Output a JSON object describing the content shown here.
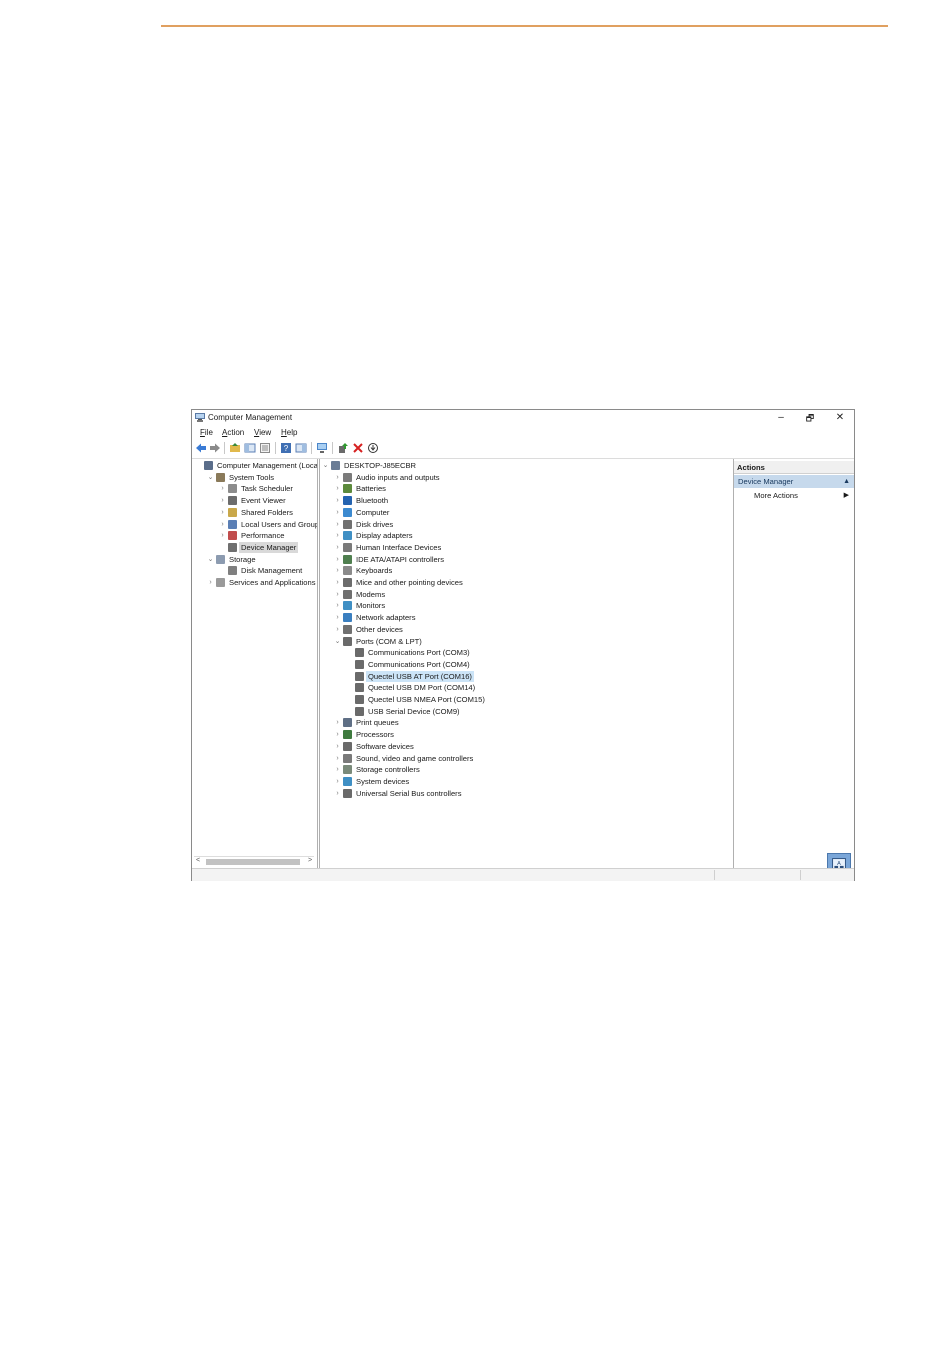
{
  "window": {
    "title": "Computer Management",
    "minimize": "–",
    "restore": "🗗",
    "close": "✕"
  },
  "menu": [
    "File",
    "Action",
    "View",
    "Help"
  ],
  "toolbar_icons": [
    "back-icon",
    "forward-icon",
    "up-folder-icon",
    "show-hide-tree-icon",
    "properties-icon",
    "help-icon",
    "show-hide-action-pane-icon",
    "computer-icon",
    "update-driver-icon",
    "uninstall-icon",
    "scan-hardware-icon"
  ],
  "left_tree": [
    {
      "label": "Computer Management (Local",
      "level": 0,
      "chev": "",
      "icon": "computer-management-icon",
      "color": "#5a6d8a"
    },
    {
      "label": "System Tools",
      "level": 1,
      "chev": "v",
      "icon": "tools-icon",
      "color": "#8a7a5a"
    },
    {
      "label": "Task Scheduler",
      "level": 2,
      "chev": ">",
      "icon": "clock-icon",
      "color": "#8c8c8c"
    },
    {
      "label": "Event Viewer",
      "level": 2,
      "chev": ">",
      "icon": "event-viewer-icon",
      "color": "#6c6c6c"
    },
    {
      "label": "Shared Folders",
      "level": 2,
      "chev": ">",
      "icon": "shared-folder-icon",
      "color": "#c9a84a"
    },
    {
      "label": "Local Users and Groups",
      "level": 2,
      "chev": ">",
      "icon": "users-icon",
      "color": "#5b7fb5"
    },
    {
      "label": "Performance",
      "level": 2,
      "chev": ">",
      "icon": "performance-icon",
      "color": "#c14d4d"
    },
    {
      "label": "Device Manager",
      "level": 2,
      "chev": "",
      "icon": "device-manager-icon",
      "color": "#6f6f6f",
      "selected": true
    },
    {
      "label": "Storage",
      "level": 1,
      "chev": "v",
      "icon": "storage-icon",
      "color": "#8c9bb0"
    },
    {
      "label": "Disk Management",
      "level": 2,
      "chev": "",
      "icon": "disk-management-icon",
      "color": "#7f7f7f"
    },
    {
      "label": "Services and Applications",
      "level": 1,
      "chev": ">",
      "icon": "services-icon",
      "color": "#9a9a9a"
    }
  ],
  "device_tree": [
    {
      "label": "DESKTOP-J85ECBR",
      "level": 0,
      "chev": "v",
      "icon": "computer-icon",
      "color": "#6a7c95"
    },
    {
      "label": "Audio inputs and outputs",
      "level": 1,
      "chev": ">",
      "icon": "audio-icon",
      "color": "#7b7b7b"
    },
    {
      "label": "Batteries",
      "level": 1,
      "chev": ">",
      "icon": "battery-icon",
      "color": "#5c8a3c"
    },
    {
      "label": "Bluetooth",
      "level": 1,
      "chev": ">",
      "icon": "bluetooth-icon",
      "color": "#2463b0"
    },
    {
      "label": "Computer",
      "level": 1,
      "chev": ">",
      "icon": "computer-icon",
      "color": "#3c8ad0"
    },
    {
      "label": "Disk drives",
      "level": 1,
      "chev": ">",
      "icon": "disk-drive-icon",
      "color": "#707070"
    },
    {
      "label": "Display adapters",
      "level": 1,
      "chev": ">",
      "icon": "display-adapter-icon",
      "color": "#3f8fc4"
    },
    {
      "label": "Human Interface Devices",
      "level": 1,
      "chev": ">",
      "icon": "hid-icon",
      "color": "#7a7a7a"
    },
    {
      "label": "IDE ATA/ATAPI controllers",
      "level": 1,
      "chev": ">",
      "icon": "ide-controller-icon",
      "color": "#4f7f4f"
    },
    {
      "label": "Keyboards",
      "level": 1,
      "chev": ">",
      "icon": "keyboard-icon",
      "color": "#8a8a8a"
    },
    {
      "label": "Mice and other pointing devices",
      "level": 1,
      "chev": ">",
      "icon": "mouse-icon",
      "color": "#6c6c6c"
    },
    {
      "label": "Modems",
      "level": 1,
      "chev": ">",
      "icon": "modem-icon",
      "color": "#6f6f6f"
    },
    {
      "label": "Monitors",
      "level": 1,
      "chev": ">",
      "icon": "monitor-icon",
      "color": "#3f8fc4"
    },
    {
      "label": "Network adapters",
      "level": 1,
      "chev": ">",
      "icon": "network-adapter-icon",
      "color": "#3a7fc0"
    },
    {
      "label": "Other devices",
      "level": 1,
      "chev": ">",
      "icon": "unknown-device-icon",
      "color": "#707070"
    },
    {
      "label": "Ports (COM & LPT)",
      "level": 1,
      "chev": "v",
      "icon": "port-icon",
      "color": "#6a6a6a"
    },
    {
      "label": "Communications Port (COM3)",
      "level": 2,
      "chev": "",
      "icon": "port-icon",
      "color": "#6a6a6a"
    },
    {
      "label": "Communications Port (COM4)",
      "level": 2,
      "chev": "",
      "icon": "port-icon",
      "color": "#6a6a6a"
    },
    {
      "label": "Quectel USB AT Port (COM16)",
      "level": 2,
      "chev": "",
      "icon": "port-icon",
      "color": "#6a6a6a",
      "highlight": true
    },
    {
      "label": "Quectel USB DM Port (COM14)",
      "level": 2,
      "chev": "",
      "icon": "port-icon",
      "color": "#6a6a6a"
    },
    {
      "label": "Quectel USB NMEA Port (COM15)",
      "level": 2,
      "chev": "",
      "icon": "port-icon",
      "color": "#6a6a6a"
    },
    {
      "label": "USB Serial Device (COM9)",
      "level": 2,
      "chev": "",
      "icon": "port-icon",
      "color": "#6a6a6a"
    },
    {
      "label": "Print queues",
      "level": 1,
      "chev": ">",
      "icon": "printer-icon",
      "color": "#5f6f85"
    },
    {
      "label": "Processors",
      "level": 1,
      "chev": ">",
      "icon": "processor-icon",
      "color": "#3e7a3e"
    },
    {
      "label": "Software devices",
      "level": 1,
      "chev": ">",
      "icon": "software-device-icon",
      "color": "#6a6a6a"
    },
    {
      "label": "Sound, video and game controllers",
      "level": 1,
      "chev": ">",
      "icon": "sound-icon",
      "color": "#7a7a7a"
    },
    {
      "label": "Storage controllers",
      "level": 1,
      "chev": ">",
      "icon": "storage-controller-icon",
      "color": "#7a8a7a"
    },
    {
      "label": "System devices",
      "level": 1,
      "chev": ">",
      "icon": "system-device-icon",
      "color": "#3f8fc4"
    },
    {
      "label": "Universal Serial Bus controllers",
      "level": 1,
      "chev": ">",
      "icon": "usb-icon",
      "color": "#6a6a6a"
    }
  ],
  "actions": {
    "header": "Actions",
    "section": "Device Manager",
    "more": "More Actions"
  },
  "colors": {
    "accent_rule": "#e0a060",
    "selection_highlight": "#cce4f7",
    "actions_section_bg": "#c6d9ec"
  }
}
